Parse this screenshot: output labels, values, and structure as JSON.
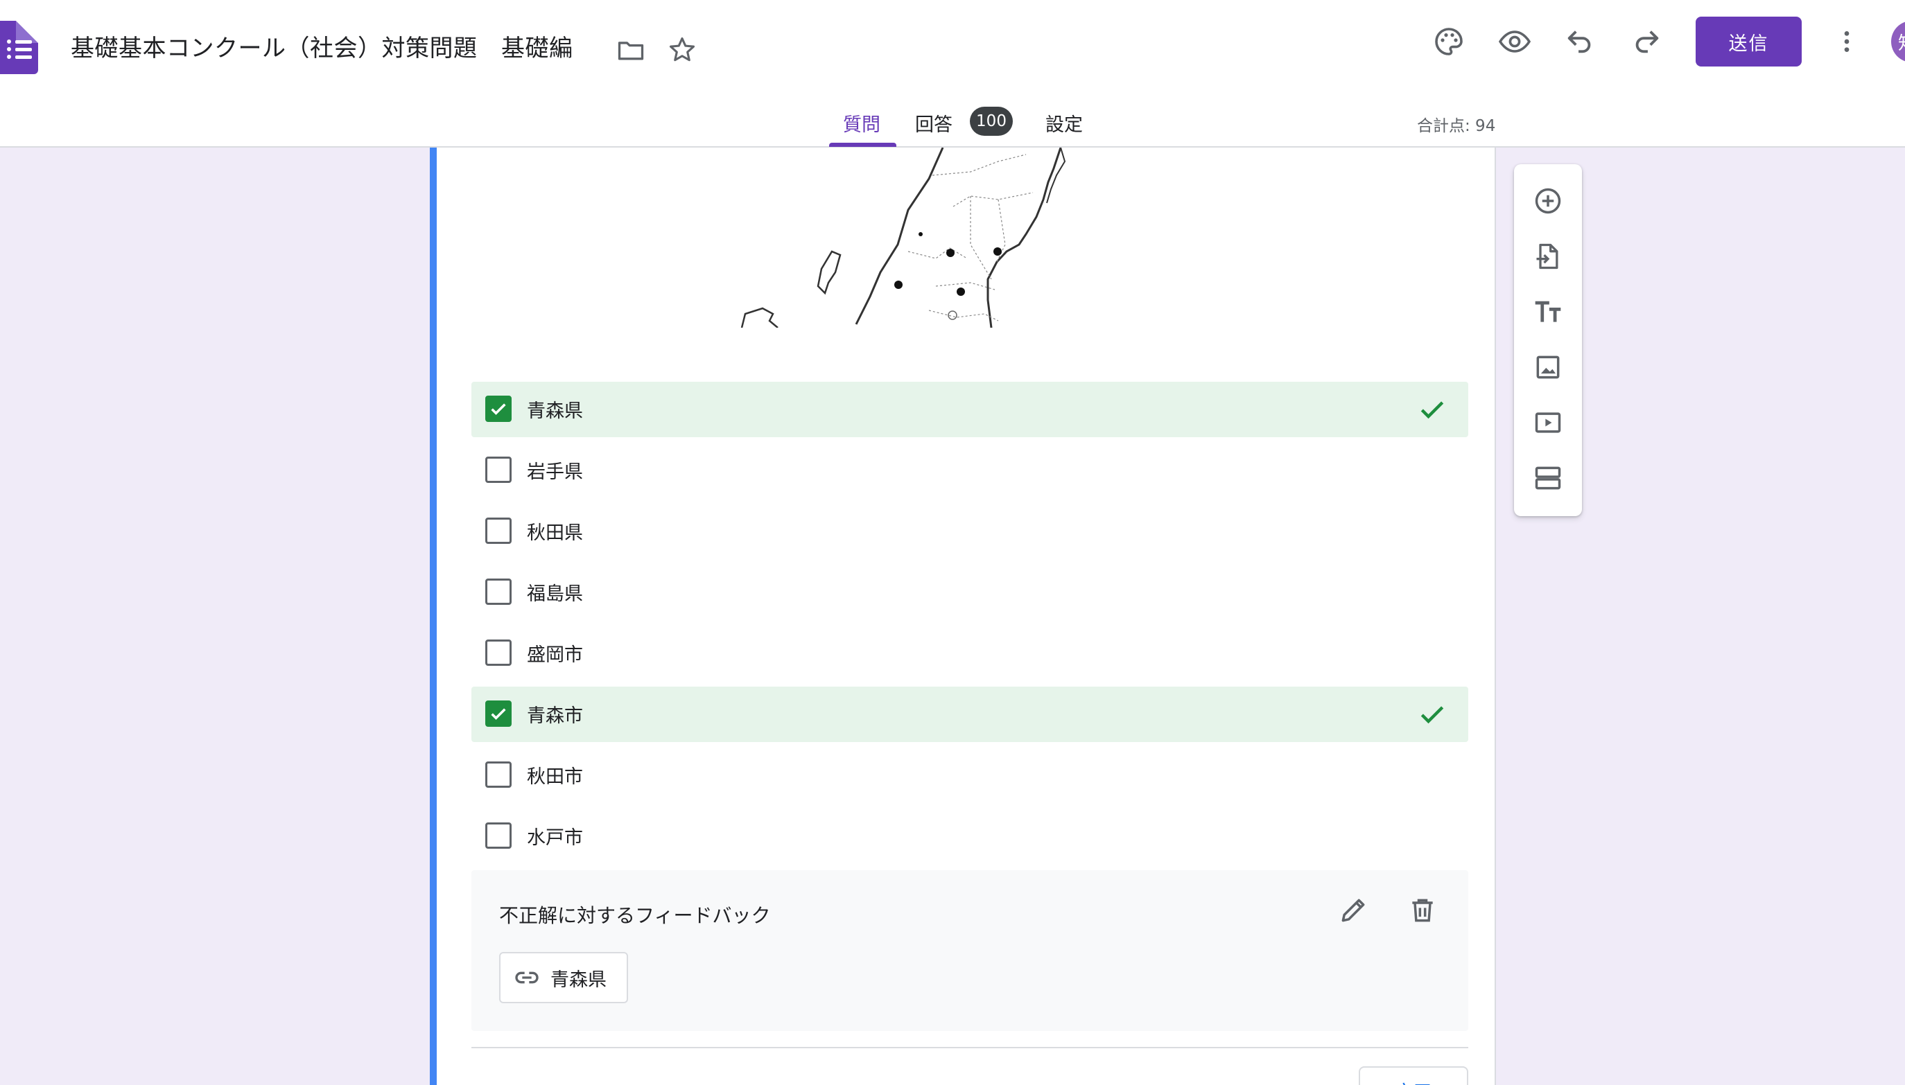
{
  "header": {
    "title": "基礎基本コンクール（社会）対策問題　基礎編",
    "send_label": "送信",
    "avatar_initial": "知",
    "icons": [
      "folder-icon",
      "star-icon",
      "palette-icon",
      "preview-icon",
      "undo-icon",
      "redo-icon",
      "more-vert-icon"
    ]
  },
  "tabs": [
    {
      "label": "質問",
      "active": true
    },
    {
      "label": "回答",
      "badge": "100"
    },
    {
      "label": "設定"
    }
  ],
  "total_points": "合計点: 94",
  "question": {
    "options": [
      {
        "label": "青森県",
        "checked": true,
        "correct": true
      },
      {
        "label": "岩手県",
        "checked": false
      },
      {
        "label": "秋田県",
        "checked": false
      },
      {
        "label": "福島県",
        "checked": false
      },
      {
        "label": "盛岡市",
        "checked": false
      },
      {
        "label": "青森市",
        "checked": true,
        "correct": true
      },
      {
        "label": "秋田市",
        "checked": false
      },
      {
        "label": "水戸市",
        "checked": false
      }
    ],
    "feedback": {
      "title": "不正解に対するフィードバック",
      "link_label": "青森県"
    },
    "done_label": "完了"
  },
  "toolbar": [
    "add-question-icon",
    "import-questions-icon",
    "add-title-icon",
    "add-image-icon",
    "add-video-icon",
    "add-section-icon"
  ],
  "colors": {
    "accent": "#673ab7",
    "card_border": "#4285f4",
    "correct_bg": "#e6f4ea",
    "correct": "#1e8e3e",
    "background": "#f0ebf8"
  }
}
